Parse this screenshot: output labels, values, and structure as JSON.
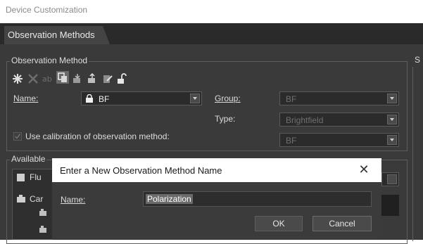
{
  "window": {
    "title": "Device Customization"
  },
  "tabs": [
    {
      "label": "Observation Methods",
      "active": true
    }
  ],
  "observation_method": {
    "group_title": "Observation Method",
    "toolbar_icons": [
      "new-star-icon",
      "delete-x-icon",
      "rename-ab-icon",
      "copy-icon",
      "import-icon",
      "export-icon",
      "edit-icon",
      "unlock-icon"
    ],
    "name_label": "Name:",
    "name_value": "BF",
    "group_label": "Group:",
    "group_value": "BF",
    "type_label": "Type:",
    "type_value": "Brightfield",
    "calibration_label": "Use calibration of observation method:",
    "calibration_value": "BF"
  },
  "available": {
    "group_title": "Available",
    "items": [
      {
        "label": "Flu"
      },
      {
        "label": "Car"
      }
    ]
  },
  "right_panel": {
    "title_fragment": "S"
  },
  "dialog": {
    "title": "Enter a New Observation Method Name",
    "name_label": "Name:",
    "name_value": "Polarization",
    "ok_label": "OK",
    "cancel_label": "Cancel"
  },
  "colors": {
    "background": "#3a3a3a",
    "tab_bar": "#2a2a2a",
    "dialog_title": "#ffffff"
  }
}
